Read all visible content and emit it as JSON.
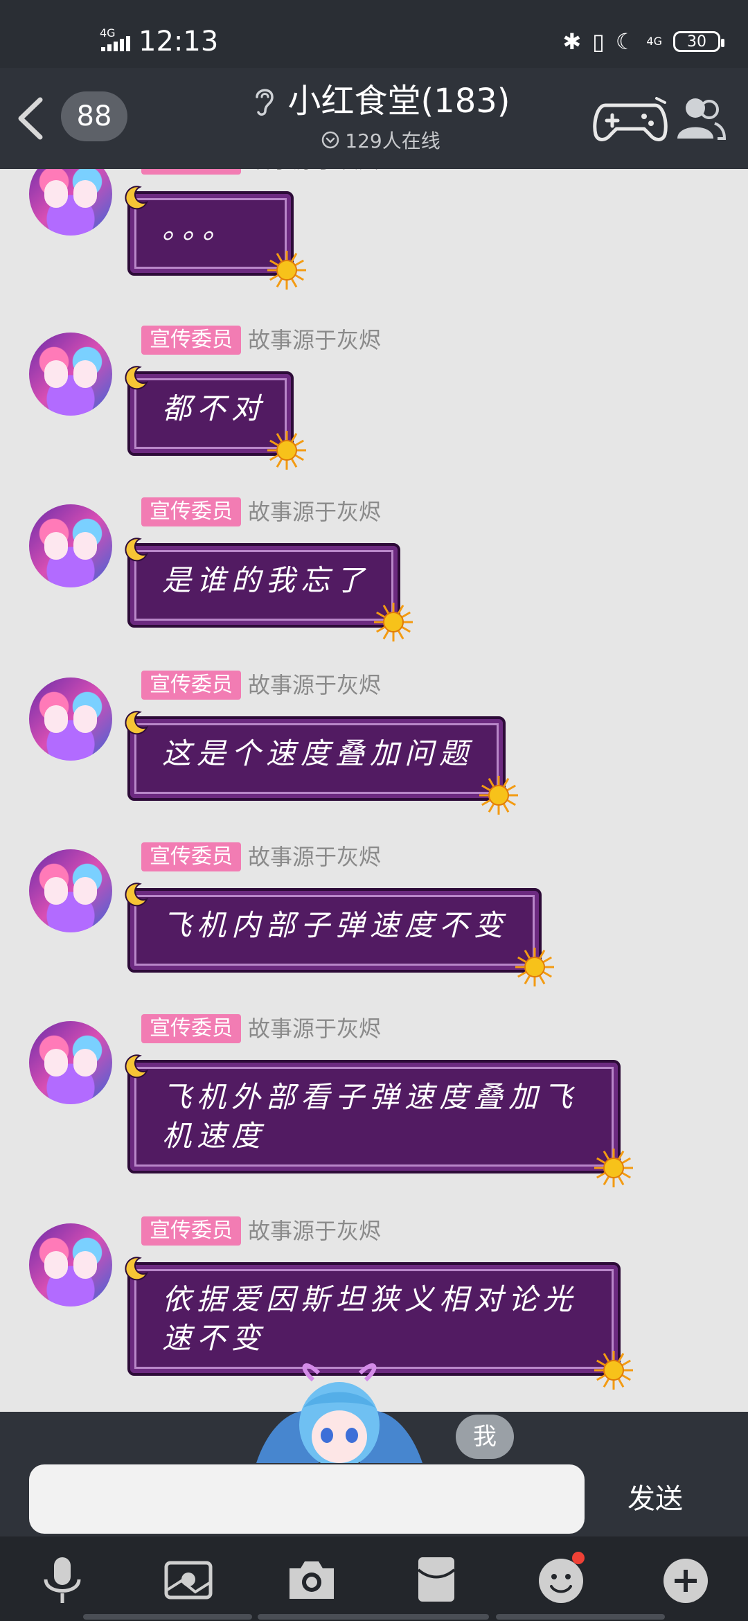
{
  "status_bar": {
    "network": "4G",
    "time": "12:13",
    "network_right": "4G",
    "battery": "30"
  },
  "header": {
    "unread_count": "88",
    "group_name": "小红食堂(183)",
    "online_text": "129人在线"
  },
  "messages": [
    {
      "role": "宣传委员",
      "sender": "故事源于灰烬",
      "text": "。。。"
    },
    {
      "role": "宣传委员",
      "sender": "故事源于灰烬",
      "text": "都不对"
    },
    {
      "role": "宣传委员",
      "sender": "故事源于灰烬",
      "text": "是谁的我忘了"
    },
    {
      "role": "宣传委员",
      "sender": "故事源于灰烬",
      "text": "这是个速度叠加问题"
    },
    {
      "role": "宣传委员",
      "sender": "故事源于灰烬",
      "text": "飞机内部子弹速度不变"
    },
    {
      "role": "宣传委员",
      "sender": "故事源于灰烬",
      "text": "飞机外部看子弹速度叠加飞机速度"
    },
    {
      "role": "宣传委员",
      "sender": "故事源于灰烬",
      "text": "依据爱因斯坦狭义相对论光速不变"
    }
  ],
  "composer": {
    "me_label": "我",
    "input_value": "",
    "send_label": "发送"
  },
  "toolbar": {
    "items": [
      "microphone-icon",
      "image-icon",
      "camera-icon",
      "red-packet-icon",
      "emoji-icon",
      "plus-icon"
    ],
    "emoji_has_notification": true
  },
  "colors": {
    "bubble": "#521b62",
    "role_badge": "#f27cb3",
    "header_bg": "#2f333a"
  }
}
